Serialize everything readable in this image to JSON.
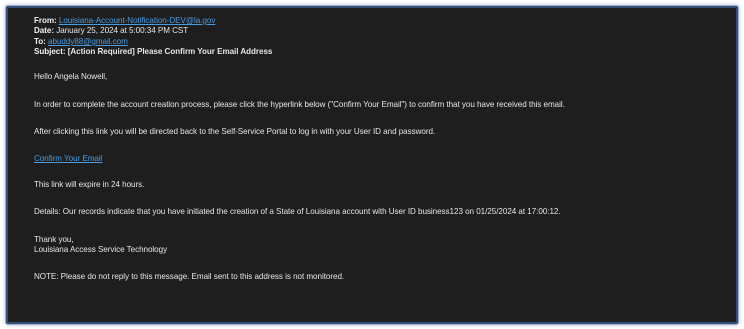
{
  "email": {
    "from_label": "From:",
    "from_value": "Louisiana-Account-Notification-DEV@la.gov",
    "date_label": "Date:",
    "date_value": "January 25, 2024 at 5:00:34 PM CST",
    "to_label": "To:",
    "to_value": "abuddy88@gmail.com",
    "subject_label": "Subject:",
    "subject_value": "[Action Required] Please Confirm Your Email Address",
    "greeting": "Hello Angela Nowell,",
    "instruction": "In order to complete the account creation process, please click the hyperlink below (\"Confirm Your Email\") to confirm that you have received this email.",
    "after_click": "After clicking this link you will be directed back to the Self-Service Portal to log in with your User ID and password.",
    "confirm_link": "Confirm Your Email",
    "expiry": "This link will expire in 24 hours.",
    "details": "Details: Our records indicate that you have initiated the creation of a State of Louisiana account with User ID business123 on 01/25/2024 at 17:00:12.",
    "signoff": "Thank you,",
    "signature": "Louisiana Access Service Technology",
    "note": "NOTE: Please do not reply to this message. Email sent to this address is not monitored."
  }
}
